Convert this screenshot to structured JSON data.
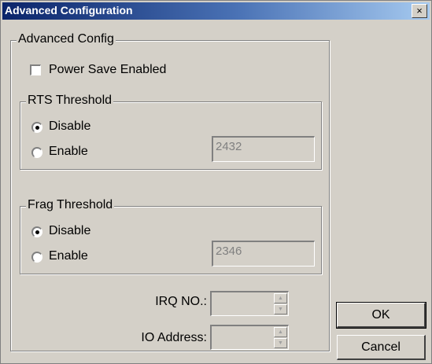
{
  "window": {
    "title": "Advanced Configuration",
    "close_label": "×"
  },
  "advanced_group": {
    "legend": "Advanced Config"
  },
  "power_save": {
    "label": "Power Save Enabled",
    "checked": false
  },
  "rts": {
    "legend": "RTS Threshold",
    "disable_label": "Disable",
    "enable_label": "Enable",
    "selected": "Disable",
    "value": "2432"
  },
  "frag": {
    "legend": "Frag Threshold",
    "disable_label": "Disable",
    "enable_label": "Enable",
    "selected": "Disable",
    "value": "2346"
  },
  "irq": {
    "label": "IRQ NO.:",
    "value": ""
  },
  "io": {
    "label": "IO Address:",
    "value": ""
  },
  "buttons": {
    "ok": "OK",
    "cancel": "Cancel"
  },
  "icons": {
    "close": "close-icon",
    "spin_up": "spin-up-icon",
    "spin_down": "spin-down-icon"
  }
}
